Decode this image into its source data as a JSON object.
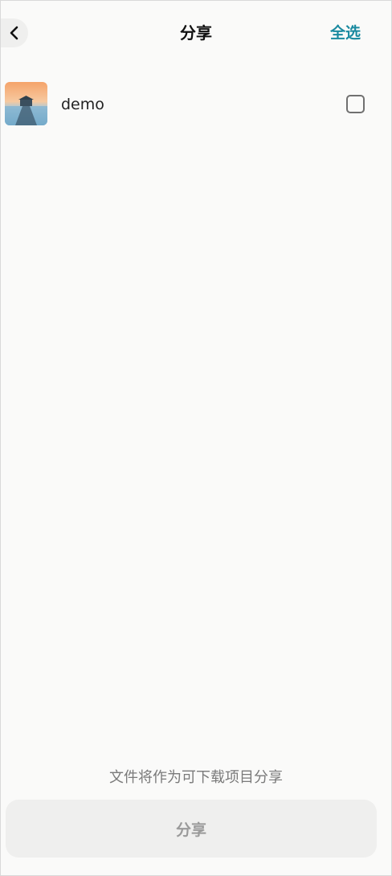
{
  "header": {
    "back_icon": "chevron-left-icon",
    "title": "分享",
    "select_all_label": "全选",
    "accent_color": "#1a8aa0"
  },
  "list": {
    "items": [
      {
        "thumbnail": "landscape-thumbnail",
        "name": "demo",
        "checked": false
      }
    ]
  },
  "footer": {
    "hint": "文件将作为可下载项目分享",
    "share_label": "分享",
    "share_enabled": false
  }
}
